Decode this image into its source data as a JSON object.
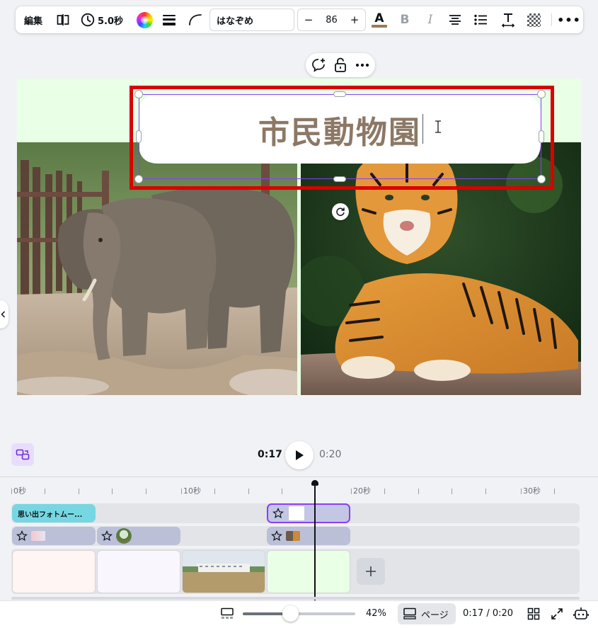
{
  "toolbar": {
    "edit_label": "編集",
    "timer_label": "5.0秒",
    "font_name": "はなぞめ",
    "font_size": "86",
    "decrease_label": "−",
    "increase_label": "+",
    "text_color_glyph": "A",
    "bold_glyph": "B",
    "italic_glyph": "I",
    "more_glyph": "•••",
    "text_color": "#9a7a5c"
  },
  "canvas": {
    "headline": "市民動物園",
    "background_color": "#e9ffe6",
    "selection_color": "#8b3dff",
    "highlight_color": "#d90000"
  },
  "player": {
    "current_time": "0:17",
    "total_time": "0:20"
  },
  "timeline": {
    "ticks": [
      "0秒",
      "10秒",
      "20秒",
      "30秒"
    ],
    "text_clip_label": "思い出フォトムー..."
  },
  "bottom": {
    "zoom": "42%",
    "zoom_fraction": 0.42,
    "pages_label": "ページ",
    "duration": "0:17 / 0:20"
  }
}
